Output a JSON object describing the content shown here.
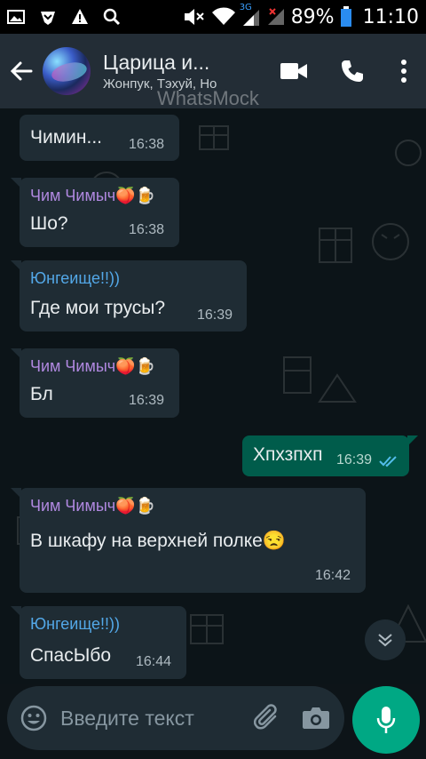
{
  "status_bar": {
    "network_label": "3G",
    "battery": "89%",
    "time": "11:10"
  },
  "header": {
    "title": "Царица и...",
    "subtitle": "Жонпук, Тэхуй, Но"
  },
  "watermark": "WhatsMock",
  "messages": [
    {
      "direction": "in",
      "sender": "",
      "text": "Чимин...",
      "time": "16:38"
    },
    {
      "direction": "in",
      "sender": "Чим Чимыч🍑🍺",
      "sender_color": "#b088e0",
      "text": "Шо?",
      "time": "16:38"
    },
    {
      "direction": "in",
      "sender": "Юнгеище!!))",
      "sender_color": "#53a8e8",
      "text": "Где мои трусы?",
      "time": "16:39"
    },
    {
      "direction": "in",
      "sender": "Чим Чимыч🍑🍺",
      "sender_color": "#b088e0",
      "text": "Бл",
      "time": "16:39"
    },
    {
      "direction": "out",
      "sender": "",
      "text": "Хпхзпхп",
      "time": "16:39",
      "status": "read"
    },
    {
      "direction": "in",
      "sender": "Чим Чимыч🍑🍺",
      "sender_color": "#b088e0",
      "text": "В шкафу на верхней полке😒",
      "time": "16:42"
    },
    {
      "direction": "in",
      "sender": "Юнгеище!!))",
      "sender_color": "#53a8e8",
      "text": "СпасЫбо",
      "time": "16:44"
    }
  ],
  "composer": {
    "placeholder": "Введите текст"
  },
  "colors": {
    "appbar": "#232d36",
    "incoming": "#1f2c34",
    "outgoing": "#005c4b",
    "accent": "#00a884",
    "read_ticks": "#53bdeb"
  },
  "icons": [
    "back-arrow-icon",
    "video-call-icon",
    "phone-icon",
    "more-vert-icon",
    "emoji-icon",
    "attach-icon",
    "camera-icon",
    "mic-icon",
    "chevron-down-icon"
  ]
}
